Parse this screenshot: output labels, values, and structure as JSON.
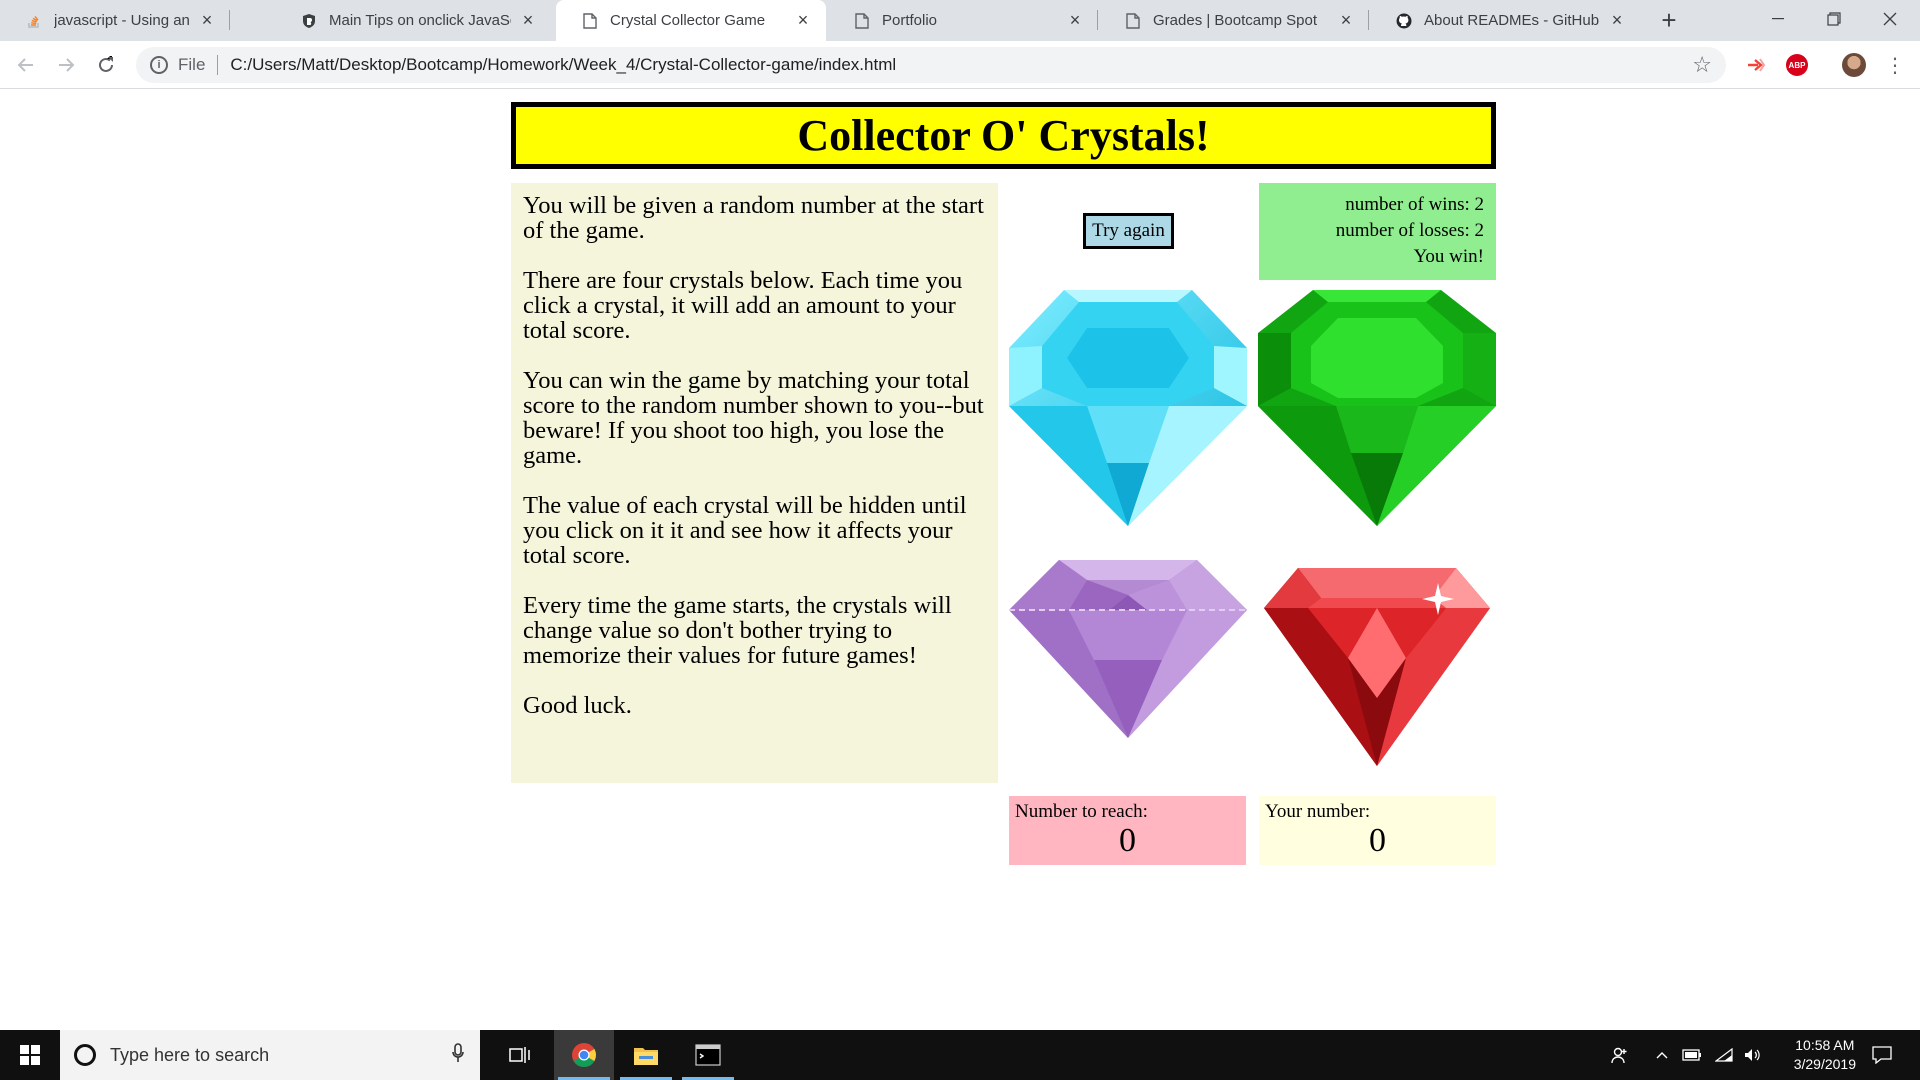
{
  "browser": {
    "tabs": [
      {
        "title": "javascript - Using an onclick f",
        "icon": "stackoverflow-icon"
      },
      {
        "title": "Main Tips on onclick JavaScri",
        "icon": "bitdegree-icon"
      },
      {
        "title": "Crystal Collector Game",
        "icon": "file-icon",
        "active": true
      },
      {
        "title": "Portfolio",
        "icon": "file-icon"
      },
      {
        "title": "Grades | Bootcamp Spot",
        "icon": "file-icon"
      },
      {
        "title": "About READMEs - GitHub He",
        "icon": "github-icon"
      }
    ],
    "address": {
      "scheme": "File",
      "url": "C:/Users/Matt/Desktop/Bootcamp/Homework/Week_4/Crystal-Collector-game/index.html"
    },
    "extensions": {
      "abp_label": "ABP"
    }
  },
  "game": {
    "title": "Collector O' Crystals!",
    "instructions": [
      "You will be given a random number at the start of the game.",
      "There are four crystals below. Each time you click a crystal, it will add an amount to your total score.",
      "You can win the game by matching your total score to the random number shown to you--but beware! If you shoot too high, you lose the game.",
      "The value of each crystal will be hidden until you click on it it and see how it affects your total score.",
      "Every time the game starts, the crystals will change value so don't bother trying to memorize their values for future games!",
      "Good luck."
    ],
    "try_again_label": "Try again",
    "wins_text": "number of wins: 2",
    "losses_text": "number of losses: 2",
    "result_text": "You win!",
    "number_to_reach": {
      "label": "Number to reach:",
      "value": "0"
    },
    "your_number": {
      "label": "Your number:",
      "value": "0"
    },
    "crystals": [
      {
        "name": "cyan-crystal",
        "color": "#2fd8f0"
      },
      {
        "name": "green-crystal",
        "color": "#16b816"
      },
      {
        "name": "purple-crystal",
        "color": "#b98ad6"
      },
      {
        "name": "red-crystal",
        "color": "#d81d20"
      }
    ],
    "colors": {
      "header_bg": "#ffff00",
      "instructions_bg": "#f5f5dc",
      "scorebox_bg": "#90ee90",
      "try_again_bg": "#add8e6",
      "number_to_reach_bg": "#ffb6c1",
      "your_number_bg": "#ffffe0"
    }
  },
  "taskbar": {
    "search_placeholder": "Type here to search",
    "time": "10:58 AM",
    "date": "3/29/2019"
  }
}
